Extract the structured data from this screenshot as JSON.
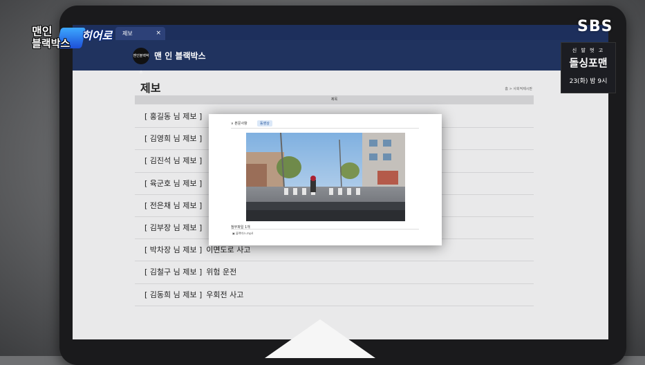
{
  "broadcast": {
    "show_logo_line1": "맨인",
    "show_logo_line2": "블랙박스",
    "segment": "히어로",
    "channel": "SBS",
    "promo_line1": "신 발 벗 고",
    "promo_line2": "돌싱포맨",
    "promo_line3": "23(화) 밤 9시"
  },
  "browser": {
    "tab_label": "제보",
    "tab_close": "×"
  },
  "site": {
    "logo_text": "맨인블랙박스",
    "title": "맨 인 블랙박스"
  },
  "page": {
    "title": "제보",
    "breadcrumb": "홈 > 사회적제시판",
    "column_header": "제목"
  },
  "reports": [
    {
      "name": "[ 홍길동 님 제보 ]",
      "subject": ""
    },
    {
      "name": "[ 김영희 님 제보 ]",
      "subject": ""
    },
    {
      "name": "[ 김진석 님 제보 ]",
      "subject": ""
    },
    {
      "name": "[ 육군호 님 제보 ]",
      "subject": ""
    },
    {
      "name": "[ 전은채 님 제보 ]",
      "subject": ""
    },
    {
      "name": "[ 김부장 님 제보 ]",
      "subject": ""
    },
    {
      "name": "[ 박차장 님 제보 ]",
      "subject": "이면도로 사고"
    },
    {
      "name": "[ 김철구 님 제보 ]",
      "subject": "위험 운전"
    },
    {
      "name": "[ 김동희 님 제보 ]",
      "subject": "우회전 사고"
    }
  ],
  "popup": {
    "section_label": "∨  본문사항",
    "badge": "동영상",
    "attachment_label": "첨부파일 1개",
    "attachment_file": "블랙박스.mp4"
  }
}
